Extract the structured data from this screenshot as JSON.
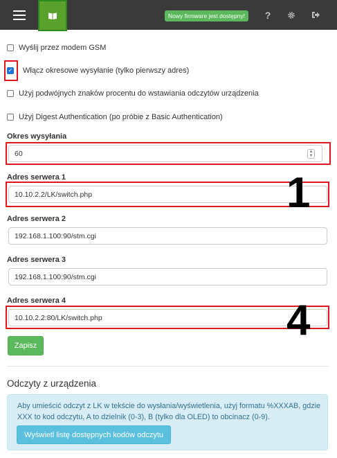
{
  "header": {
    "firmware_badge": "Nowy firmware jest dostępny!",
    "icons": [
      "menu-icon",
      "book-icon",
      "help-icon",
      "gear-icon",
      "logout-icon"
    ],
    "help_glyph": "?",
    "accent_color": "#5aa02c"
  },
  "options": {
    "gsm": {
      "label": "Wyślij przez modem GSM",
      "checked": false
    },
    "periodic": {
      "label": "Włącz okresowe wysyłanie (tylko pierwszy adres)",
      "checked": true
    },
    "double_percent": {
      "label": "Użyj podwójnych znaków procentu do wstawiania odczytów urządzenia",
      "checked": false
    },
    "digest": {
      "label": "Użyj Digest Authentication (po próbie z Basic Authentication)",
      "checked": false
    }
  },
  "period": {
    "label": "Okres wysyłania",
    "value": "60"
  },
  "servers": [
    {
      "label": "Adres serwera 1",
      "value": "10.10.2.2/LK/switch.php"
    },
    {
      "label": "Adres serwera 2",
      "value": "192.168.1.100:90/stm.cgi"
    },
    {
      "label": "Adres serwera 3",
      "value": "192.168.1.100:90/stm.cgi"
    },
    {
      "label": "Adres serwera 4",
      "value": "10.10.2.2:80/LK/switch.php"
    }
  ],
  "annotations": {
    "one": "1",
    "four": "4",
    "highlight_color": "#e0161e"
  },
  "save_label": "Zapisz",
  "readings": {
    "title": "Odczyty z urządzenia",
    "info": "Aby umieścić odczyt z LK w tekście do wysłania/wyświetlenia, użyj formatu %XXXAB, gdzie XXX to kod odczytu, A to dzielnik (0-3), B (tylko dla OLED) to obcinacz (0-9).",
    "button_label": "Wyświetl listę dostępnych kodów odczytu"
  }
}
